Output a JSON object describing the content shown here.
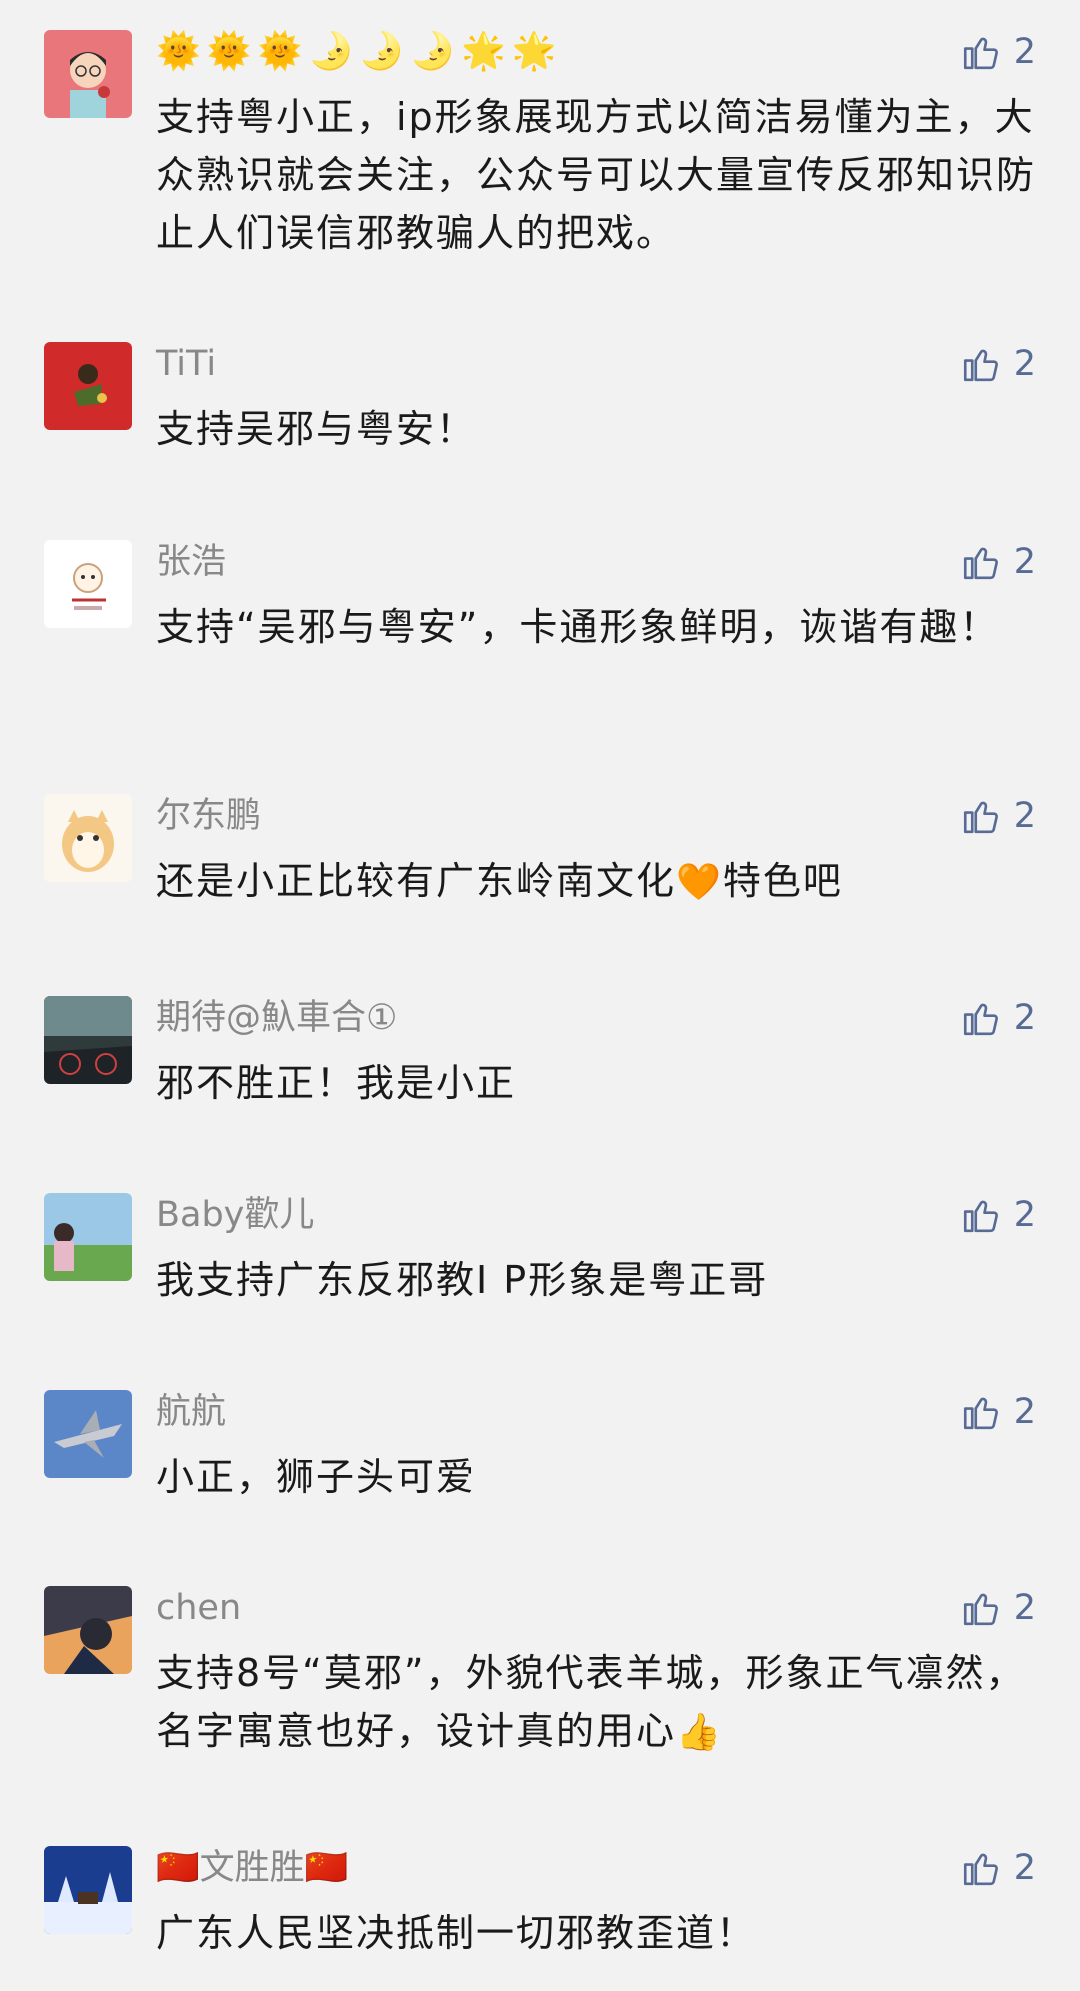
{
  "colors": {
    "background": "#f2f2f2",
    "nickname": "#888888",
    "text": "#1a1a1a",
    "like": "#576b95"
  },
  "icons": {
    "like": "thumbs-up-icon"
  },
  "comments": [
    {
      "nickname": "🌞🌞🌞🌛🌛🌛🌟🌟",
      "text": "支持粤小正，ip形象展现方式以简洁易懂为主，大众熟识就会关注，公众号可以大量宣传反邪知识防止人们误信邪教骗人的把戏。",
      "likes": "2"
    },
    {
      "nickname": "TiTi",
      "text": "支持吴邪与粤安！",
      "likes": "2"
    },
    {
      "nickname": "张浩",
      "text": "支持“吴邪与粤安”，卡通形象鲜明，诙谐有趣！",
      "likes": "2"
    },
    {
      "nickname": "尔东鹏",
      "text": "还是小正比较有广东岭南文化",
      "text_emoji": "🧡",
      "text_after": "特色吧",
      "likes": "2"
    },
    {
      "nickname": "期待@魞車合①",
      "text": "邪不胜正！我是小正",
      "likes": "2"
    },
    {
      "nickname": "Baby歡儿",
      "text": "我支持广东反邪教I P形象是粤正哥",
      "likes": "2"
    },
    {
      "nickname": "航航",
      "text": "小正，狮子头可爱",
      "likes": "2"
    },
    {
      "nickname": "chen",
      "text": "支持8号“莫邪”，外貌代表羊城，形象正气凛然，名字寓意也好，设计真的用心",
      "text_emoji": "👍",
      "likes": "2"
    },
    {
      "nickname": "🇨🇳文胜胜🇨🇳",
      "text": "广东人民坚决抵制一切邪教歪道！",
      "likes": "2"
    }
  ]
}
